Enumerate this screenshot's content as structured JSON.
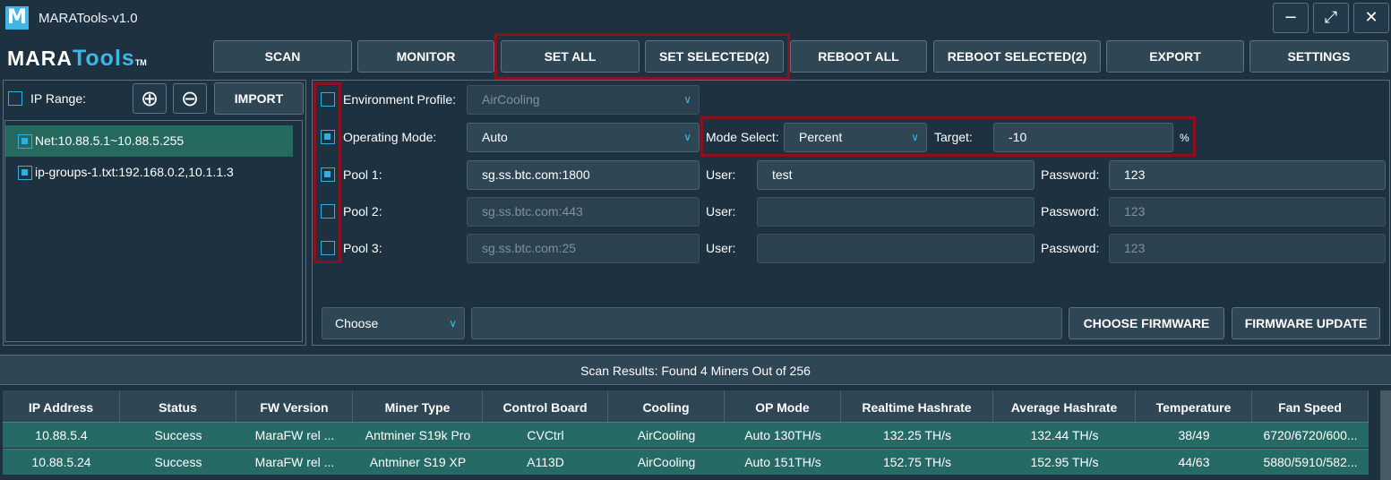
{
  "window": {
    "icon_letter": "M",
    "title": "MARATools-v1.0",
    "controls": {
      "minimize": "−",
      "maximize": "⤢",
      "close": "✕"
    }
  },
  "logo": {
    "part1": "MARA",
    "part2": "Tools",
    "tm": "TM"
  },
  "toolbar": {
    "scan": "SCAN",
    "monitor": "MONITOR",
    "set_all": "SET ALL",
    "set_selected": "SET SELECTED(2)",
    "reboot_all": "REBOOT ALL",
    "reboot_selected": "REBOOT SELECTED(2)",
    "export": "EXPORT",
    "settings": "SETTINGS"
  },
  "left": {
    "ip_range_label": "IP Range:",
    "ip_range_checked": false,
    "add_icon": "⊕",
    "remove_icon": "⊖",
    "import_label": "IMPORT",
    "items": [
      {
        "label": "Net:10.88.5.1~10.88.5.255",
        "checked": true,
        "selected": true
      },
      {
        "label": "ip-groups-1.txt:192.168.0.2,10.1.1.3",
        "checked": true,
        "selected": false
      }
    ]
  },
  "config": {
    "env_profile": {
      "label": "Environment Profile:",
      "value": "AirCooling",
      "checked": false
    },
    "op_mode": {
      "label": "Operating Mode:",
      "value": "Auto",
      "checked": true
    },
    "mode_select": {
      "label": "Mode Select:",
      "value": "Percent"
    },
    "target": {
      "label": "Target:",
      "value": "-10",
      "unit": "%"
    },
    "pools": [
      {
        "label": "Pool 1:",
        "url": "sg.ss.btc.com:1800",
        "user_label": "User:",
        "user": "test",
        "password_label": "Password:",
        "password": "123",
        "checked": true
      },
      {
        "label": "Pool 2:",
        "url": "sg.ss.btc.com:443",
        "user_label": "User:",
        "user": "",
        "password_label": "Password:",
        "password": "123",
        "checked": false
      },
      {
        "label": "Pool 3:",
        "url": "sg.ss.btc.com:25",
        "user_label": "User:",
        "user": "",
        "password_label": "Password:",
        "password": "123",
        "checked": false
      }
    ],
    "firmware_choose": "Choose",
    "firmware_path": "",
    "choose_firmware_label": "CHOOSE FIRMWARE",
    "firmware_update_label": "FIRMWARE UPDATE"
  },
  "status": {
    "text": "Scan Results: Found 4 Miners Out of 256"
  },
  "table": {
    "columns": [
      "IP Address",
      "Status",
      "FW Version",
      "Miner Type",
      "Control Board",
      "Cooling",
      "OP Mode",
      "Realtime Hashrate",
      "Average Hashrate",
      "Temperature",
      "Fan Speed"
    ],
    "rows": [
      [
        "10.88.5.4",
        "Success",
        "MaraFW rel ...",
        "Antminer S19k Pro",
        "CVCtrl",
        "AirCooling",
        "Auto 130TH/s",
        "132.25 TH/s",
        "132.44 TH/s",
        "38/49",
        "6720/6720/600..."
      ],
      [
        "10.88.5.24",
        "Success",
        "MaraFW rel ...",
        "Antminer S19 XP",
        "A113D",
        "AirCooling",
        "Auto 151TH/s",
        "152.75 TH/s",
        "152.95 TH/s",
        "44/63",
        "5880/5910/582..."
      ]
    ]
  },
  "colors": {
    "background": "#1d3140",
    "accent": "#3fb6e6",
    "highlight_box": "#8b1020",
    "row_selected": "#266a65"
  }
}
